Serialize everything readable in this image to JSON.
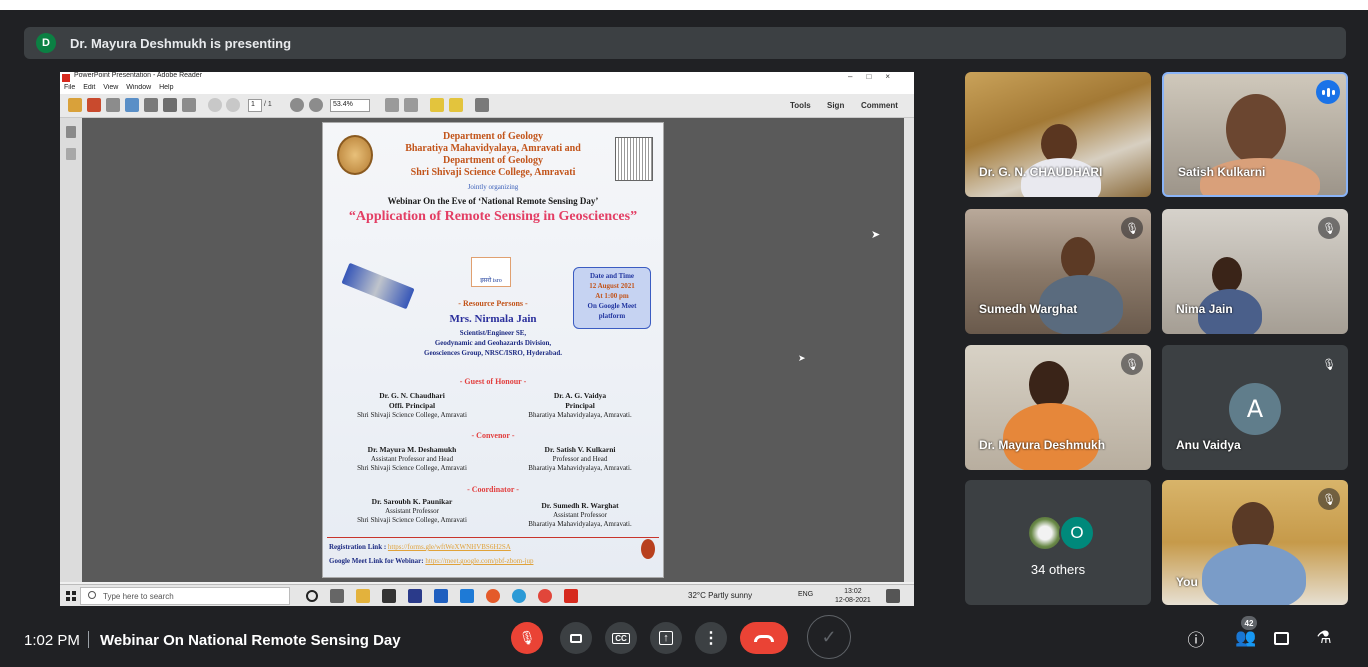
{
  "banner": {
    "avatar_letter": "D",
    "text": "Dr. Mayura Deshmukh is presenting"
  },
  "reader": {
    "title": "PowerPoint Presentation - Adobe Reader",
    "menu": [
      "File",
      "Edit",
      "View",
      "Window",
      "Help"
    ],
    "page_current": "1",
    "page_total": "/ 1",
    "zoom": "53.4%",
    "tools": "Tools",
    "sign": "Sign",
    "comment": "Comment"
  },
  "poster": {
    "dept1": "Department of Geology",
    "college1": "Bharatiya Mahavidyalaya, Amravati and",
    "dept2": "Department of Geology",
    "college2": "Shri Shivaji Science College, Amravati",
    "jointly": "Jointly organizing",
    "eve": "Webinar On the Eve of ‘National Remote Sensing Day’",
    "app_title": "“Application of Remote Sensing in Geosciences”",
    "isro": "इसरो isro",
    "date_head": "Date and Time",
    "date": "12 August 2021",
    "time": "At 1:00 pm",
    "platform": "On Google Meet platform",
    "resource_head": "- Resource Persons -",
    "resource_name": "Mrs. Nirmala Jain",
    "resource_line1": "Scientist/Engineer SE,",
    "resource_line2": "Geodynamic and Geohazards Division,",
    "resource_line3": "Geosciences Group, NRSC/ISRO, Hyderabad.",
    "guest_head": "- Guest of Honour -",
    "guest_left_name": "Dr. G. N. Chaudhari",
    "guest_left_role": "Offi. Principal",
    "guest_left_org": "Shri Shivaji Science College, Amravati",
    "guest_right_name": "Dr. A. G. Vaidya",
    "guest_right_role": "Principal",
    "guest_right_org": "Bharatiya Mahavidyalaya, Amravati.",
    "convenor_head": "- Convenor -",
    "conv_left_name": "Dr. Mayura M. Deshamukh",
    "conv_left_role": "Assistant Professor and Head",
    "conv_left_org": "Shri Shivaji Science College, Amravati",
    "conv_right_name": "Dr. Satish V. Kulkarni",
    "conv_right_role": "Professor and Head",
    "conv_right_org": "Bharatiya Mahavidyalaya, Amravati.",
    "coord_head": "- Coordinator -",
    "coord_left_name": "Dr. Saroubh K. Paunikar",
    "coord_left_role": "Assistant Professor",
    "coord_left_org": "Shri Shivaji Science College, Amravati",
    "coord_right_name": "Dr. Sumedh R. Warghat",
    "coord_right_role": "Assistant Professor",
    "coord_right_org": "Bharatiya Mahavidyalaya, Amravati.",
    "reg_label": "Registration Link :",
    "reg_link": "https://forms.gle/wftWeXWNHVBS6H2SA",
    "meet_label": "Google Meet Link for Webinar:",
    "meet_link": "https://meet.google.com/pbf-zbom-jup"
  },
  "taskbar": {
    "search": "Type here to search",
    "weather": "32°C  Partly sunny",
    "lang": "ENG",
    "time": "13:02",
    "date": "12-08-2021"
  },
  "participants": [
    {
      "name": "Dr. G. N. CHAUDHARI"
    },
    {
      "name": "Satish Kulkarni"
    },
    {
      "name": "Sumedh Warghat"
    },
    {
      "name": "Nima Jain"
    },
    {
      "name": "Dr. Mayura Deshmukh"
    },
    {
      "name": "Anu Vaidya",
      "avatar": "A"
    },
    {
      "name": "34 others",
      "avatar": "O"
    },
    {
      "name": "You"
    }
  ],
  "bottom": {
    "time": "1:02 PM",
    "meeting_title": "Webinar On National Remote Sensing Day",
    "people_count": "42"
  },
  "colors": {
    "background": "#202124",
    "tile": "#3c4043",
    "red": "#ea4335",
    "accent": "#1a73e8"
  }
}
